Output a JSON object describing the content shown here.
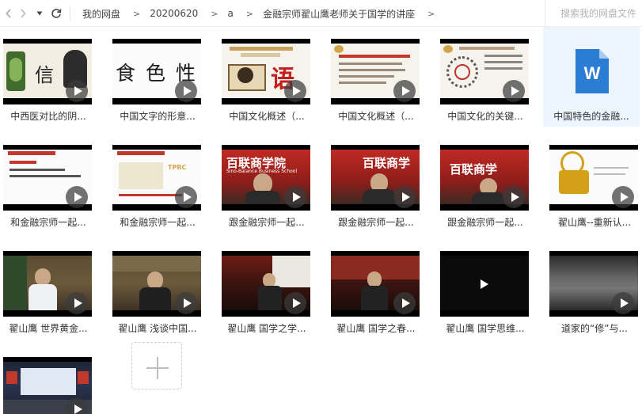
{
  "toolbar": {
    "back_icon": "chevron-left-icon",
    "forward_icon": "chevron-right-icon",
    "history_icon": "caret-down-icon",
    "refresh_icon": "refresh-icon"
  },
  "breadcrumb": [
    {
      "label": "我的网盘"
    },
    {
      "label": "20200620"
    },
    {
      "label": "a"
    },
    {
      "label": "金融宗师翟山鹰老师关于国学的讲座"
    }
  ],
  "breadcrumb_separator": ">",
  "search": {
    "placeholder": "搜索我的网盘文件",
    "value": ""
  },
  "files": [
    {
      "name": "中西医对比的阴...",
      "type": "video"
    },
    {
      "name": "中国文字的形意...",
      "type": "video"
    },
    {
      "name": "中国文化概述（...",
      "type": "video"
    },
    {
      "name": "中国文化概述（...",
      "type": "video"
    },
    {
      "name": "中国文化的关键...",
      "type": "video"
    },
    {
      "name": "中国特色的金融...",
      "type": "doc",
      "icon_letter": "W",
      "selected": true
    },
    {
      "name": "和金融宗师一起...",
      "type": "video"
    },
    {
      "name": "和金融宗师一起...",
      "type": "video"
    },
    {
      "name": "跟金融宗师一起...",
      "type": "video"
    },
    {
      "name": "跟金融宗师一起...",
      "type": "video"
    },
    {
      "name": "跟金融宗师一起...",
      "type": "video"
    },
    {
      "name": "翟山鹰--重新认...",
      "type": "video"
    },
    {
      "name": "翟山鹰 世界黄金...",
      "type": "video"
    },
    {
      "name": "翟山鹰 浅谈中国...",
      "type": "video"
    },
    {
      "name": "翟山鹰 国学之学...",
      "type": "video"
    },
    {
      "name": "翟山鹰 国学之春...",
      "type": "video"
    },
    {
      "name": "翟山鹰 国学思维...",
      "type": "video"
    },
    {
      "name": "道家的“修”与...",
      "type": "video"
    },
    {
      "name": "",
      "type": "video"
    }
  ],
  "thumb_text": {
    "t1_chars": [
      "信"
    ],
    "t2_chars": [
      "食",
      "色",
      "性"
    ],
    "t3_char": "语",
    "t9_sign": "百联商学院",
    "t9_sub": "Sino-Balance Business School",
    "t10_sign": "百联商学",
    "t11_sign": "百联商学",
    "t6_heading": "TPRC"
  },
  "colors": {
    "accent": "#1e7bd6",
    "word_blue": "#2b7cd3",
    "selection_bg": "#edf5ff",
    "red_sign": "#c3201f"
  }
}
